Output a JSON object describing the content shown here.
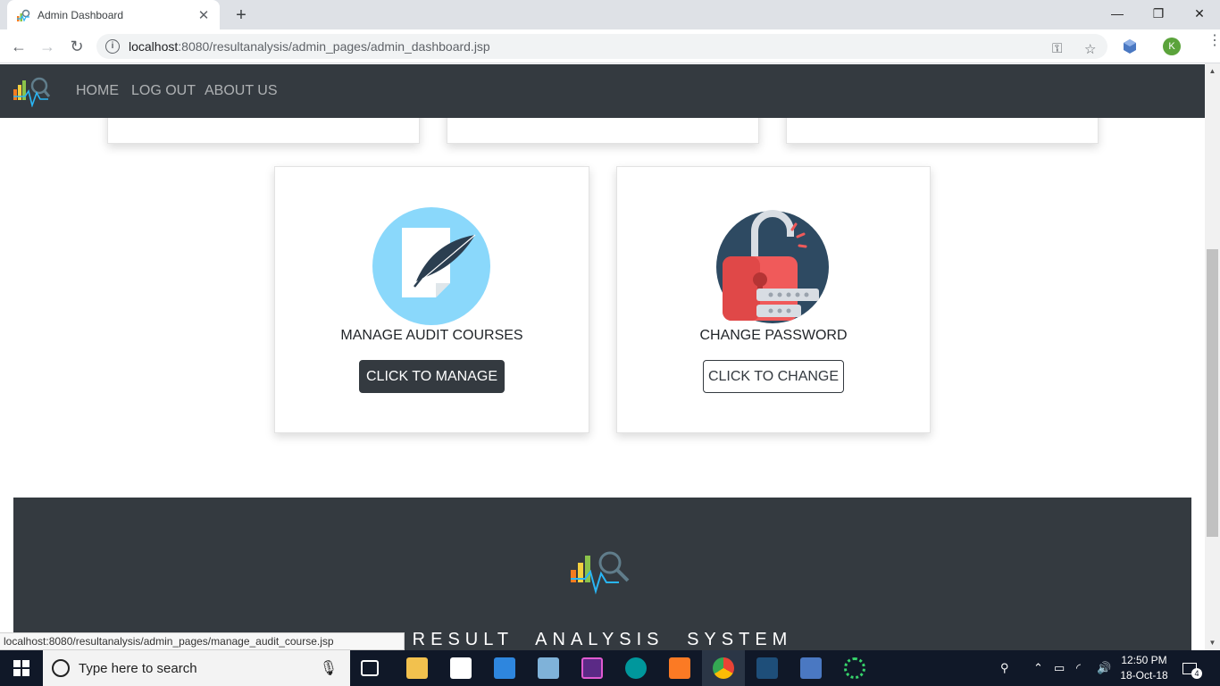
{
  "browser": {
    "tab_title": "Admin Dashboard",
    "url_host": "localhost",
    "url_rest": ":8080/resultanalysis/admin_pages/admin_dashboard.jsp",
    "profile_initial": "K",
    "status_url": "localhost:8080/resultanalysis/admin_pages/manage_audit_course.jsp"
  },
  "navbar": {
    "links": [
      "HOME",
      "LOG OUT",
      "ABOUT US"
    ]
  },
  "cards": [
    {
      "label": "MANAGE AUDIT COURSES",
      "button": "CLICK TO MANAGE"
    },
    {
      "label": "CHANGE PASSWORD",
      "button": "CLICK TO CHANGE"
    }
  ],
  "footer": {
    "title": "RESULT ANALYSIS SYSTEM"
  },
  "taskbar": {
    "search_placeholder": "Type here to search",
    "time": "12:50 PM",
    "date": "18-Oct-18",
    "notification_count": "4"
  },
  "colors": {
    "navbar_bg": "#343a40",
    "feather_circle": "#8ad8fb",
    "lock_circle": "#2e4a62",
    "lock_body": "#f05a5a"
  }
}
